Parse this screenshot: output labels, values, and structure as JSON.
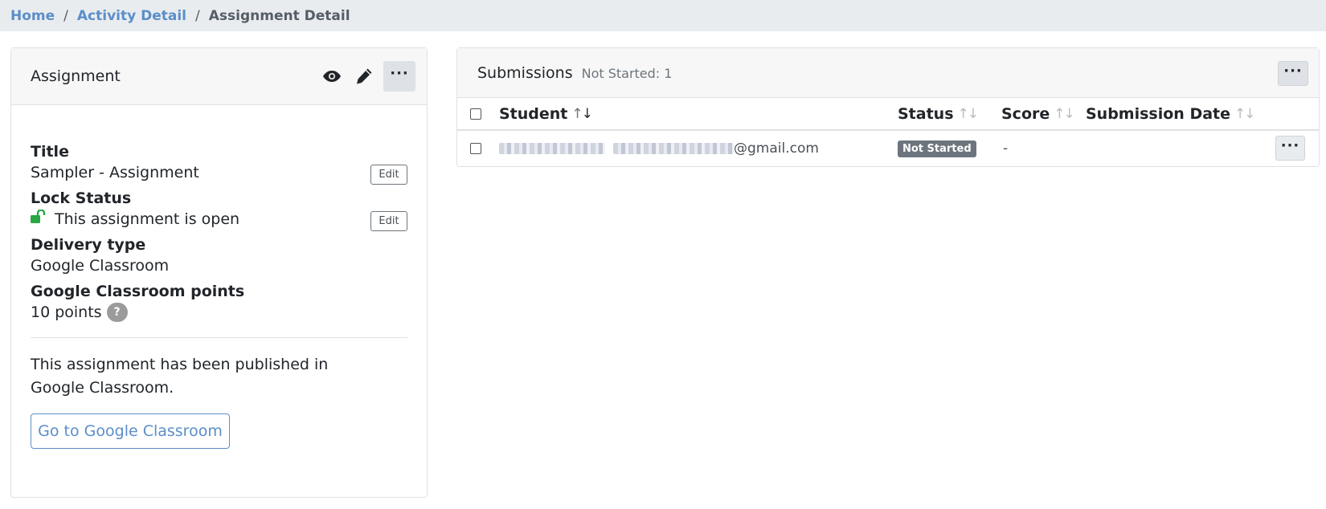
{
  "breadcrumb": {
    "home": "Home",
    "activity": "Activity Detail",
    "current": "Assignment Detail",
    "separator": "/"
  },
  "assignment_card": {
    "title": "Assignment",
    "icons": [
      "eye-icon",
      "pencil-icon",
      "more-icon"
    ],
    "more_label": "···",
    "fields": {
      "title_label": "Title",
      "title_value": "Sampler - Assignment",
      "lock_label": "Lock Status",
      "lock_value": "This assignment is open",
      "delivery_label": "Delivery type",
      "delivery_value": "Google Classroom",
      "points_label": "Google Classroom points",
      "points_value": "10 points",
      "help_symbol": "?"
    },
    "edit_label": "Edit",
    "published_text": "This assignment has been published in Google Classroom.",
    "gc_button_label": "Go to Google Classroom"
  },
  "submissions_card": {
    "title": "Submissions",
    "count_text": "Not Started: 1",
    "more_label": "···",
    "columns": [
      "Student",
      "Status",
      "Score",
      "Submission Date"
    ],
    "sort_up": "↑",
    "sort_down": "↓",
    "rows": [
      {
        "email_suffix": "@gmail.com",
        "status": "Not Started",
        "score": "-",
        "submission_date": ""
      }
    ]
  },
  "colors": {
    "link": "#5b8ec9",
    "lock_open": "#28a745",
    "badge": "#6c757d",
    "header_bg": "#f7f7f7"
  }
}
